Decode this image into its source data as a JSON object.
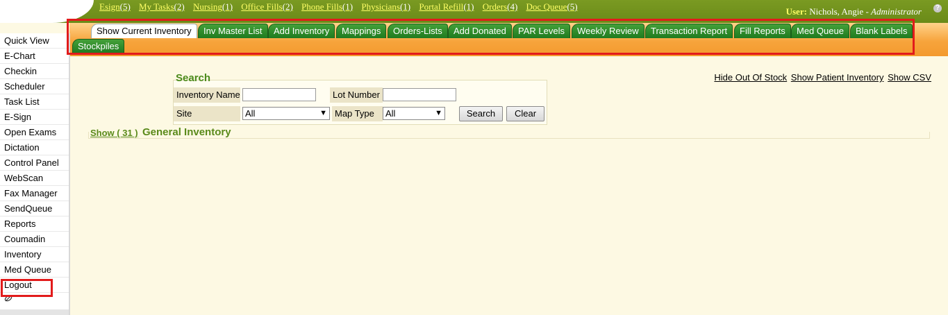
{
  "topbar": {
    "links": [
      {
        "label": "Esign",
        "count": "(5)"
      },
      {
        "label": "My Tasks",
        "count": "(2)"
      },
      {
        "label": "Nursing",
        "count": "(1)"
      },
      {
        "label": "Office Fills",
        "count": "(2)"
      },
      {
        "label": "Phone Fills",
        "count": "(1)"
      },
      {
        "label": "Physicians",
        "count": "(1)"
      },
      {
        "label": "Portal Refill",
        "count": "(1)"
      },
      {
        "label": "Orders",
        "count": "(4)"
      },
      {
        "label": "Doc Queue",
        "count": "(5)"
      }
    ],
    "user_label": "User:",
    "user_name": "Nichols, Angie",
    "user_sep": " - ",
    "user_role": "Administrator",
    "help_glyph": "?"
  },
  "tabs": [
    {
      "label": "Show Current Inventory",
      "active": true
    },
    {
      "label": "Inv Master List"
    },
    {
      "label": "Add Inventory"
    },
    {
      "label": "Mappings"
    },
    {
      "label": "Orders-Lists"
    },
    {
      "label": "Add Donated"
    },
    {
      "label": "PAR Levels"
    },
    {
      "label": "Weekly Review"
    },
    {
      "label": "Transaction Report"
    },
    {
      "label": "Fill Reports"
    },
    {
      "label": "Med Queue"
    },
    {
      "label": "Blank Labels"
    },
    {
      "label": "Stockpiles"
    }
  ],
  "sidebar": {
    "items": [
      "Quick View",
      "E-Chart",
      "Checkin",
      "Scheduler",
      "Task List",
      "E-Sign",
      "Open Exams",
      "Dictation",
      "Control Panel",
      "WebScan",
      "Fax Manager",
      "SendQueue",
      "Reports",
      "Coumadin",
      "Inventory",
      "Med Queue",
      "Logout"
    ],
    "selected": "Inventory"
  },
  "search": {
    "title": "Search",
    "inventory_name_label": "Inventory Name",
    "inventory_name_value": "",
    "lot_number_label": "Lot Number",
    "lot_number_value": "",
    "site_label": "Site",
    "site_value": "All",
    "map_type_label": "Map Type",
    "map_type_value": "All",
    "search_button": "Search",
    "clear_button": "Clear"
  },
  "right_links": [
    "Hide Out Of Stock",
    "Show Patient Inventory",
    "Show CSV"
  ],
  "section": {
    "show_label": "Show ( 31 )",
    "title": "General Inventory"
  }
}
